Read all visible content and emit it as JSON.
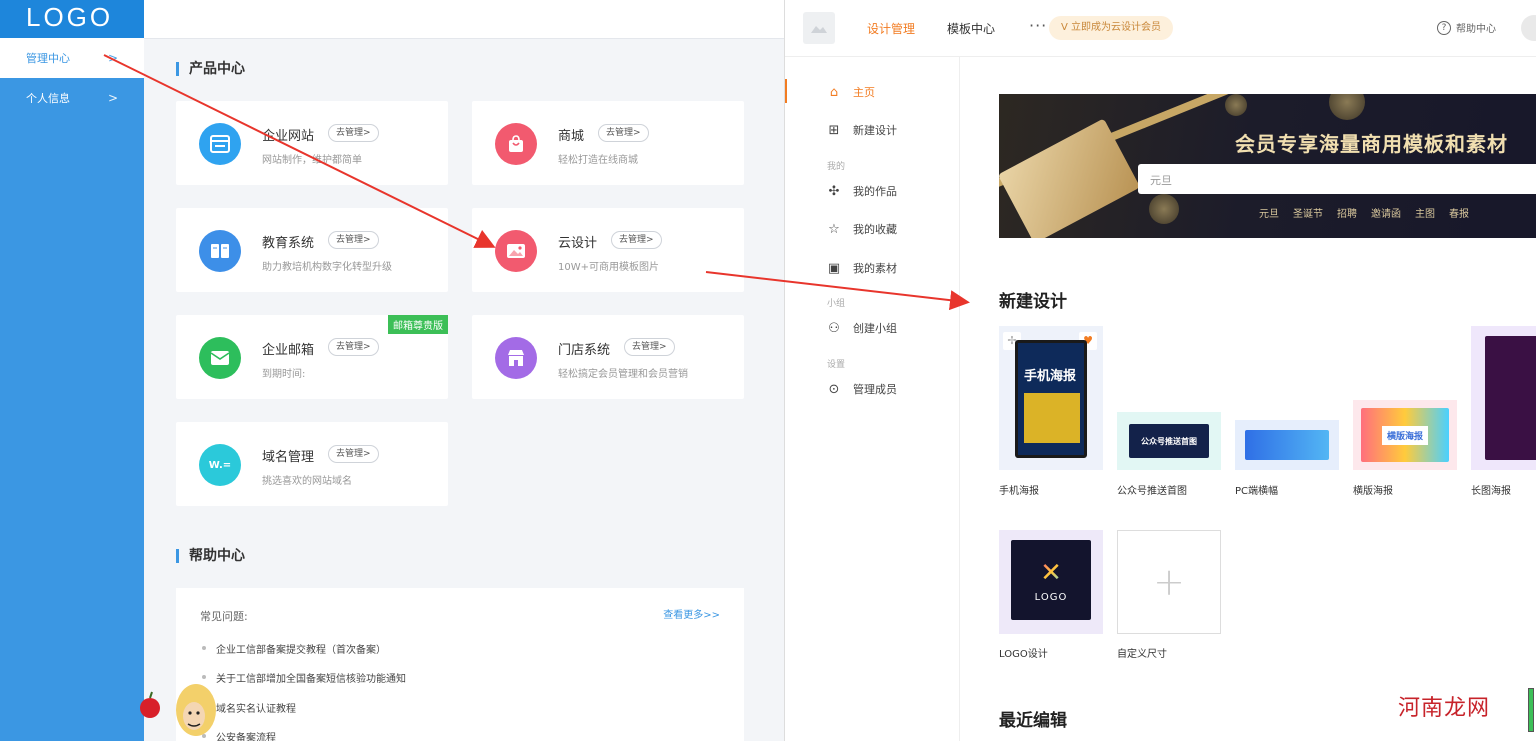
{
  "sidebar": {
    "logo": "LOGO",
    "items": [
      {
        "label": "管理中心",
        "active": true
      },
      {
        "label": "个人信息",
        "active": false
      }
    ]
  },
  "product_center": {
    "title": "产品中心",
    "cards": [
      {
        "name": "企业网站",
        "action": "去管理>",
        "desc": "网站制作，维护都简单",
        "icon": "website-icon",
        "color": "#2fa3f0"
      },
      {
        "name": "商城",
        "action": "去管理>",
        "desc": "轻松打造在线商城",
        "icon": "shopping-bag-icon",
        "color": "#f25a6f"
      },
      {
        "name": "教育系统",
        "action": "去管理>",
        "desc": "助力教培机构数字化转型升级",
        "icon": "book-icon",
        "color": "#3d8fe8"
      },
      {
        "name": "云设计",
        "action": "去管理>",
        "desc": "10W+可商用模板图片",
        "icon": "image-icon",
        "color": "#f25a6f"
      },
      {
        "name": "企业邮箱",
        "action": "去管理>",
        "desc": "到期时间:",
        "icon": "mail-icon",
        "color": "#2dbe5c",
        "flag": "邮箱尊贵版"
      },
      {
        "name": "门店系统",
        "action": "去管理>",
        "desc": "轻松搞定会员管理和会员营销",
        "icon": "store-icon",
        "color": "#a36be6"
      },
      {
        "name": "域名管理",
        "action": "去管理>",
        "desc": "挑选喜欢的网站域名",
        "icon": "domain-icon",
        "color": "#2bc9da",
        "icon_text": "W.="
      }
    ]
  },
  "help_center": {
    "title": "帮助中心",
    "faq_label": "常见问题:",
    "more": "查看更多>>",
    "items": [
      "企业工信部备案提交教程（首次备案）",
      "关于工信部增加全国备案短信核验功能通知",
      "域名实名认证教程",
      "公安备案流程"
    ]
  },
  "design_app": {
    "logo_text": "设计管理",
    "nav": [
      {
        "label": "设计管理",
        "active": true
      },
      {
        "label": "模板中心",
        "active": false
      }
    ],
    "more": "···",
    "vip": "立即成为云设计会员",
    "help": "帮助中心",
    "side": {
      "home": "主页",
      "new": "新建设计",
      "group_mine": "我的",
      "works": "我的作品",
      "favorites": "我的收藏",
      "materials": "我的素材",
      "group_team": "小组",
      "create_team": "创建小组",
      "group_settings": "设置",
      "members": "管理成员"
    },
    "banner": {
      "title": "会员专享海量商用模板和素材",
      "search_placeholder": "元旦",
      "tags": [
        "元旦",
        "圣诞节",
        "招聘",
        "邀请函",
        "主图",
        "春报"
      ]
    },
    "new_design_title": "新建设计",
    "templates": [
      {
        "label": "手机海报",
        "thumb_text": "手机海报"
      },
      {
        "label": "公众号推送首图",
        "thumb_text": "公众号推送首图"
      },
      {
        "label": "PC端横幅",
        "thumb_text": ""
      },
      {
        "label": "横版海报",
        "thumb_text": "横版海报"
      },
      {
        "label": "长图海报",
        "thumb_text": ""
      },
      {
        "label": "LOGO设计",
        "thumb_text": "LOGO"
      },
      {
        "label": "自定义尺寸",
        "thumb_text": "+"
      }
    ],
    "recent_title": "最近编辑"
  },
  "watermark": "河南龙网"
}
